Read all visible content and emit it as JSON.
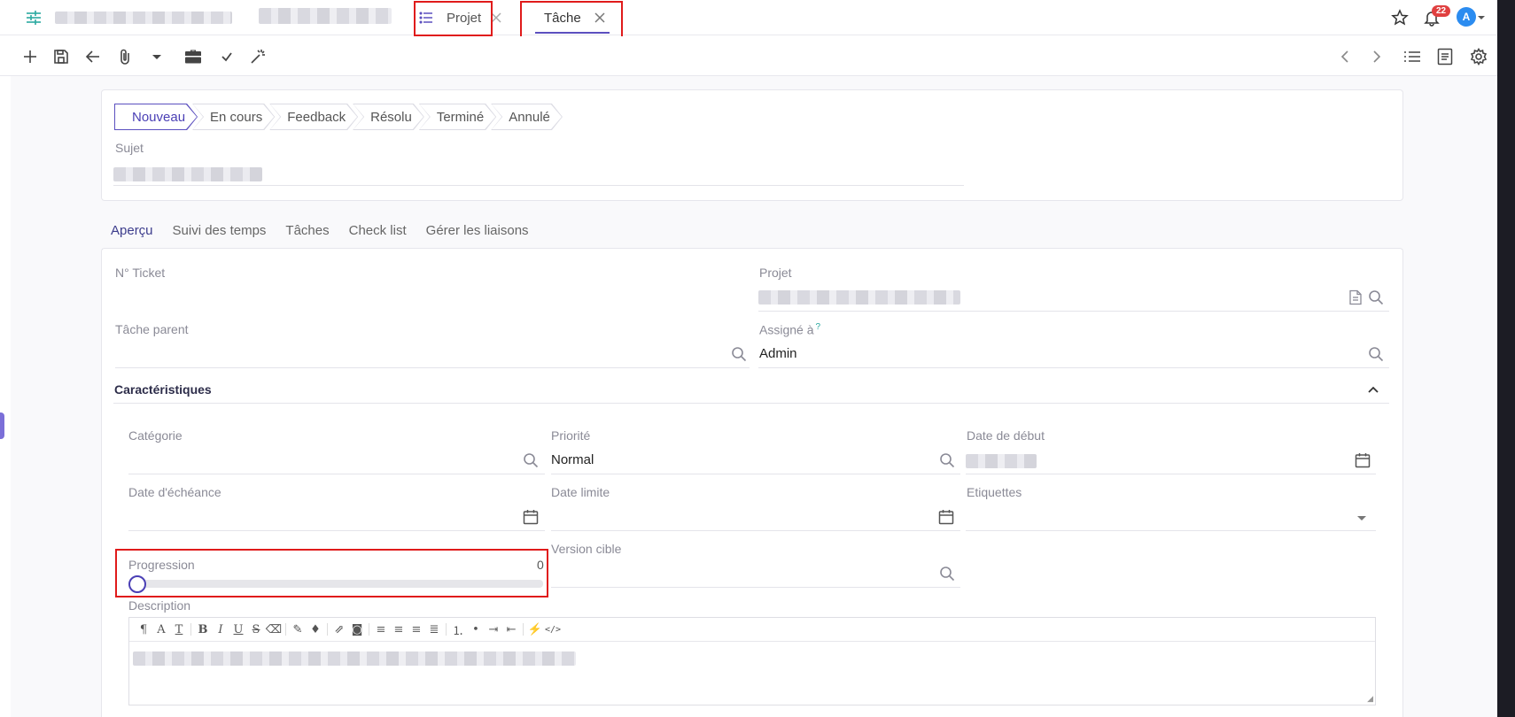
{
  "tabs": [
    {
      "label": "Projet",
      "closable": true,
      "active": false
    },
    {
      "label": "Tâche",
      "closable": true,
      "active": true
    }
  ],
  "notifications": {
    "count": "22"
  },
  "user": {
    "initial": "A"
  },
  "status_steps": [
    "Nouveau",
    "En cours",
    "Feedback",
    "Résolu",
    "Terminé",
    "Annulé"
  ],
  "status_active": "Nouveau",
  "subject": {
    "label": "Sujet"
  },
  "subtabs": [
    "Aperçu",
    "Suivi des temps",
    "Tâches",
    "Check list",
    "Gérer les liaisons"
  ],
  "fields": {
    "ticket": {
      "label": "N° Ticket",
      "value": ""
    },
    "project": {
      "label": "Projet"
    },
    "parent_task": {
      "label": "Tâche parent",
      "value": ""
    },
    "assigned": {
      "label": "Assigné à",
      "hint": "?",
      "value": "Admin"
    }
  },
  "characteristics": {
    "title": "Caractéristiques",
    "category": {
      "label": "Catégorie",
      "value": ""
    },
    "priority": {
      "label": "Priorité",
      "value": "Normal"
    },
    "start_date": {
      "label": "Date de début"
    },
    "due_date": {
      "label": "Date d'échéance",
      "value": ""
    },
    "deadline": {
      "label": "Date limite",
      "value": ""
    },
    "tags": {
      "label": "Etiquettes",
      "value": ""
    },
    "progress": {
      "label": "Progression",
      "value": "0"
    },
    "target_version": {
      "label": "Version cible",
      "value": ""
    },
    "description": {
      "label": "Description"
    }
  },
  "colors": {
    "accent": "#5b4fbf",
    "highlight": "#e01b1b",
    "menu_icon": "#2aa8a0",
    "badge": "#e04040",
    "avatar": "#2b8cf0"
  }
}
